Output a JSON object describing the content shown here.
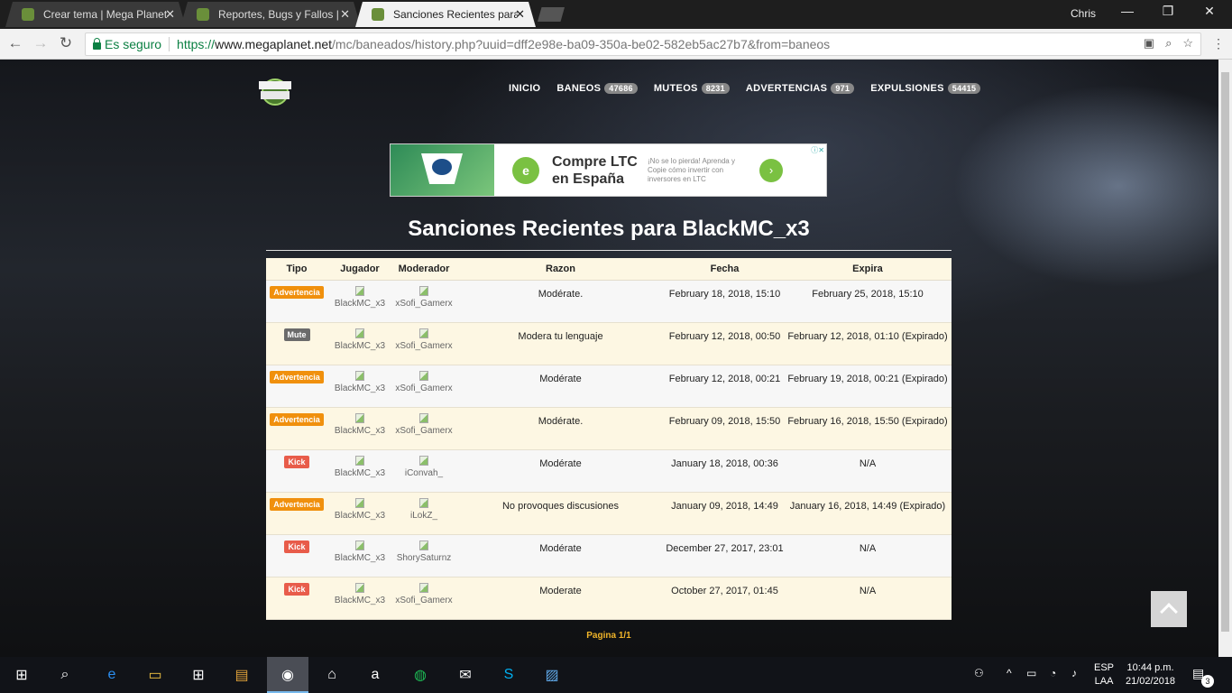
{
  "browser": {
    "tabs": [
      {
        "title": "Crear tema | Mega Planet"
      },
      {
        "title": "Reportes, Bugs y Fallos | M"
      },
      {
        "title": "Sanciones Recientes para"
      }
    ],
    "user": "Chris",
    "secure_label": "Es seguro",
    "url_scheme": "https://",
    "url_host": "www.megaplanet.net",
    "url_path": "/mc/baneados/history.php?uuid=dff2e98e-ba09-350a-be02-582eb5ac27b7&from=baneos"
  },
  "site": {
    "logo_text": "MEGA PLANET",
    "nav": [
      {
        "label": "INICIO",
        "count": ""
      },
      {
        "label": "BANEOS",
        "count": "47686"
      },
      {
        "label": "MUTEOS",
        "count": "8231"
      },
      {
        "label": "ADVERTENCIAS",
        "count": "971"
      },
      {
        "label": "EXPULSIONES",
        "count": "54415"
      }
    ]
  },
  "ad": {
    "title": "Compre LTC en España",
    "text": "¡No se lo pierda! Aprenda y Copie cómo invertir con inversores en LTC",
    "logo": "e"
  },
  "page": {
    "title": "Sanciones Recientes para BlackMC_x3",
    "pagination": "Pagina 1/1"
  },
  "table": {
    "headers": {
      "tipo": "Tipo",
      "jugador": "Jugador",
      "moderador": "Moderador",
      "razon": "Razon",
      "fecha": "Fecha",
      "expira": "Expira"
    },
    "rows": [
      {
        "tipo": "Advertencia",
        "jugador": "BlackMC_x3",
        "moderador": "xSofi_Gamerx",
        "razon": "Modérate.",
        "fecha": "February 18, 2018, 15:10",
        "expira": "February 25, 2018, 15:10"
      },
      {
        "tipo": "Mute",
        "jugador": "BlackMC_x3",
        "moderador": "xSofi_Gamerx",
        "razon": "Modera tu lenguaje",
        "fecha": "February 12, 2018, 00:50",
        "expira": "February 12, 2018, 01:10 (Expirado)"
      },
      {
        "tipo": "Advertencia",
        "jugador": "BlackMC_x3",
        "moderador": "xSofi_Gamerx",
        "razon": "Modérate",
        "fecha": "February 12, 2018, 00:21",
        "expira": "February 19, 2018, 00:21 (Expirado)"
      },
      {
        "tipo": "Advertencia",
        "jugador": "BlackMC_x3",
        "moderador": "xSofi_Gamerx",
        "razon": "Modérate.",
        "fecha": "February 09, 2018, 15:50",
        "expira": "February 16, 2018, 15:50 (Expirado)"
      },
      {
        "tipo": "Kick",
        "jugador": "BlackMC_x3",
        "moderador": "iConvah_",
        "razon": "Modérate",
        "fecha": "January 18, 2018, 00:36",
        "expira": "N/A"
      },
      {
        "tipo": "Advertencia",
        "jugador": "BlackMC_x3",
        "moderador": "iLokZ_",
        "razon": "No provoques discusiones",
        "fecha": "January 09, 2018, 14:49",
        "expira": "January 16, 2018, 14:49 (Expirado)"
      },
      {
        "tipo": "Kick",
        "jugador": "BlackMC_x3",
        "moderador": "ShorySaturnz",
        "razon": "Modérate",
        "fecha": "December 27, 2017, 23:01",
        "expira": "N/A"
      },
      {
        "tipo": "Kick",
        "jugador": "BlackMC_x3",
        "moderador": "xSofi_Gamerx",
        "razon": "Moderate",
        "fecha": "October 27, 2017, 01:45",
        "expira": "N/A"
      }
    ]
  },
  "badge_colors": {
    "Advertencia": "#f0900d",
    "Mute": "#6b6b6b",
    "Kick": "#e85c4a"
  },
  "taskbar": {
    "lang_top": "ESP",
    "lang_bottom": "LAA",
    "time": "10:44 p.m.",
    "date": "21/02/2018",
    "notifications": "3"
  }
}
